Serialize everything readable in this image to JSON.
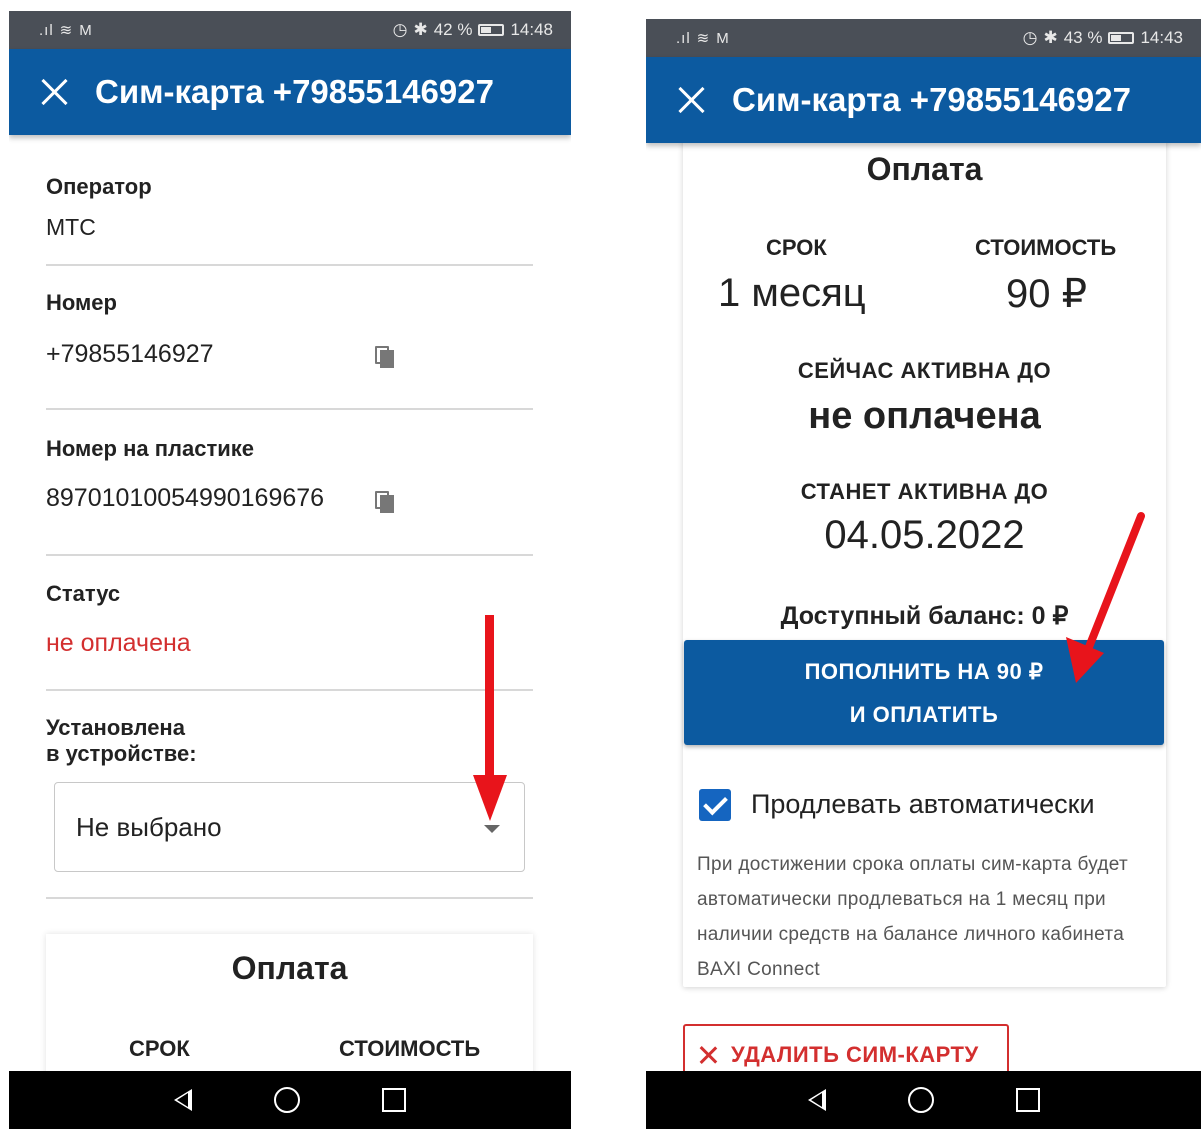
{
  "left": {
    "status_bar": {
      "signal": ".ıl",
      "wifi": "≋",
      "mail": "M",
      "alarm": "◷",
      "bluetooth": "✱",
      "battery_pct": "42 %",
      "time": "14:48"
    },
    "app_bar": {
      "title": "Сим-карта +79855146927"
    },
    "fields": {
      "operator_label": "Оператор",
      "operator_value": "МТС",
      "number_label": "Номер",
      "number_value": "+79855146927",
      "plastic_label": "Номер на пластике",
      "plastic_value": "89701010054990169676",
      "status_label": "Статус",
      "status_value": "не оплачена",
      "installed_label_line1": "Установлена",
      "installed_label_line2": "в устройстве:",
      "device_select_value": "Не выбрано"
    },
    "payment": {
      "title": "Оплата",
      "term_label": "СРОК",
      "cost_label": "СТОИМОСТЬ"
    }
  },
  "right": {
    "status_bar": {
      "signal": ".ıl",
      "wifi": "≋",
      "mail": "M",
      "alarm": "◷",
      "bluetooth": "✱",
      "battery_pct": "43 %",
      "time": "14:43"
    },
    "app_bar": {
      "title": "Сим-карта +79855146927"
    },
    "payment": {
      "title": "Оплата",
      "term_label": "СРОК",
      "term_value": "1 месяц",
      "cost_label": "СТОИМОСТЬ",
      "cost_value": "90 ₽",
      "active_now_label": "СЕЙЧАС АКТИВНА ДО",
      "active_now_value": "не оплачена",
      "will_be_active_label": "СТАНЕТ АКТИВНА ДО",
      "will_be_active_value": "04.05.2022",
      "balance_text": "Доступный баланс: 0 ₽",
      "pay_button_line1": "ПОПОЛНИТЬ НА 90 ₽",
      "pay_button_line2": "И ОПЛАТИТЬ",
      "auto_renew_label": "Продлевать автоматически",
      "auto_renew_checked": true,
      "auto_renew_hint": "При достижении срока оплаты сим-карта будет автоматически продлеваться на 1 месяц при наличии средств на балансе личного кабинета BAXI Connect"
    },
    "delete_button_label": "УДАЛИТЬ СИМ-КАРТУ"
  },
  "colors": {
    "primary": "#0c5aa0",
    "status_unpaid": "#d32f2f",
    "arrow": "#e8141b",
    "checkbox": "#1565c0"
  }
}
